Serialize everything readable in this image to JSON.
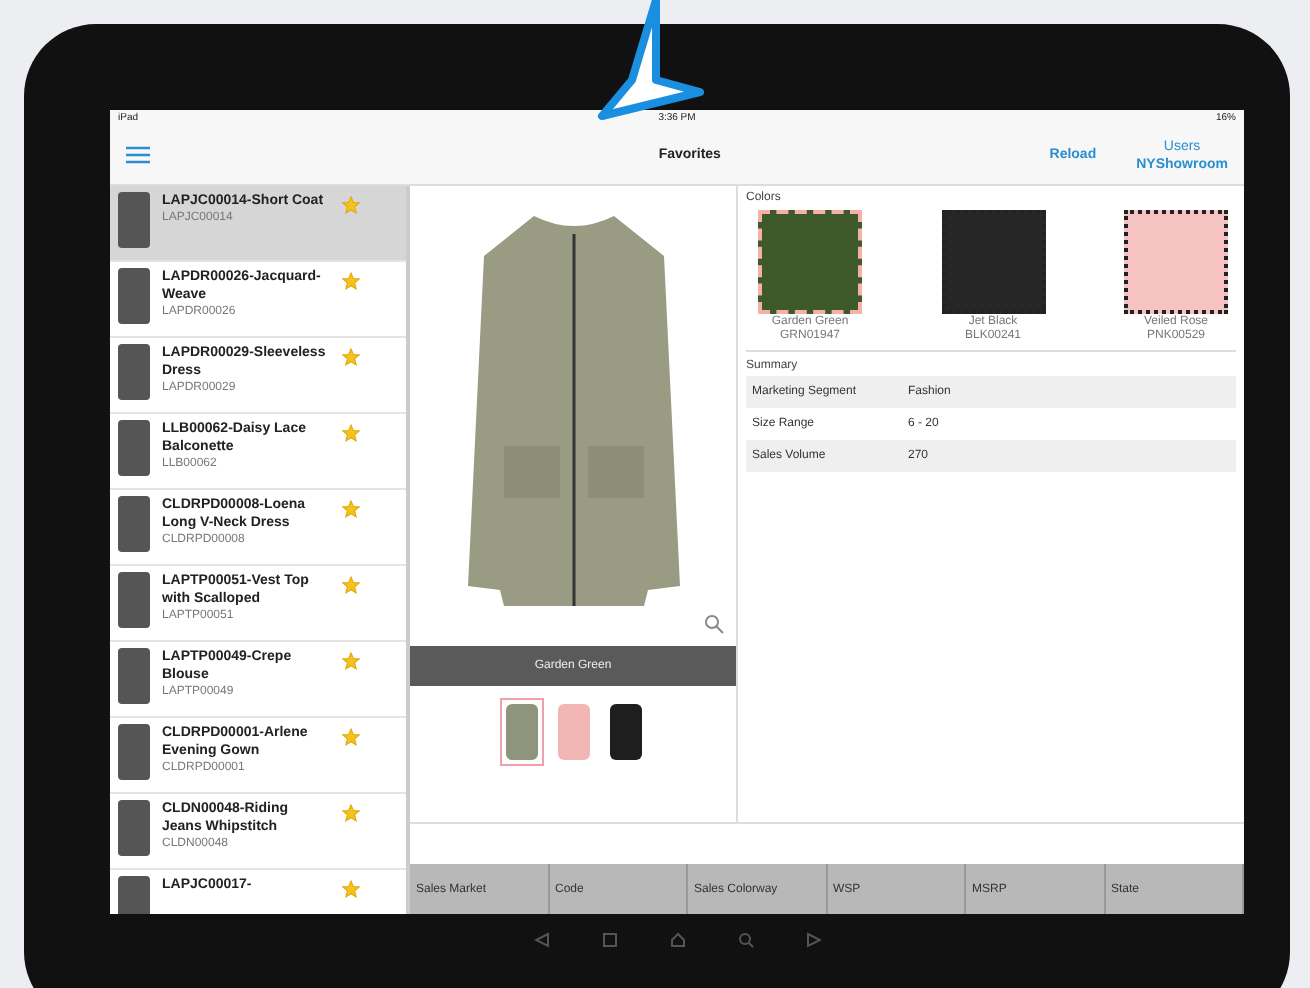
{
  "status_bar": {
    "device": "iPad",
    "time": "3:36 PM",
    "battery": "16%"
  },
  "nav_bar": {
    "title": "Favorites",
    "reload": "Reload",
    "users_label": "Users",
    "users_value": "NYShowroom"
  },
  "items": [
    {
      "title": "LAPJC00014-Short Coat",
      "code": "LAPJC00014",
      "selected": true,
      "favorite": true
    },
    {
      "title": "LAPDR00026-Jacquard-Weave",
      "code": "LAPDR00026",
      "selected": false,
      "favorite": true
    },
    {
      "title": "LAPDR00029-Sleeveless Dress",
      "code": "LAPDR00029",
      "selected": false,
      "favorite": true
    },
    {
      "title": "LLB00062-Daisy Lace Balconette",
      "code": "LLB00062",
      "selected": false,
      "favorite": true
    },
    {
      "title": "CLDRPD00008-Loena Long V-Neck Dress",
      "code": "CLDRPD00008",
      "selected": false,
      "favorite": true
    },
    {
      "title": "LAPTP00051-Vest Top with Scalloped",
      "code": "LAPTP00051",
      "selected": false,
      "favorite": true
    },
    {
      "title": "LAPTP00049-Crepe Blouse",
      "code": "LAPTP00049",
      "selected": false,
      "favorite": true
    },
    {
      "title": "CLDRPD00001-Arlene Evening Gown",
      "code": "CLDRPD00001",
      "selected": false,
      "favorite": true
    },
    {
      "title": "CLDN00048-Riding Jeans Whipstitch",
      "code": "CLDN00048",
      "selected": false,
      "favorite": true
    },
    {
      "title": "LAPJC00017-",
      "selected": false,
      "favorite": true
    }
  ],
  "image_caption": "Garden Green",
  "thumbnails": [
    {
      "color": "#8e957a",
      "selected": true
    },
    {
      "color": "#f2b7b5",
      "selected": false
    },
    {
      "color": "#1e1e1e",
      "selected": false
    }
  ],
  "colors": {
    "label": "Colors",
    "swatches": [
      {
        "name": "Garden Green",
        "code": "GRN01947",
        "color": "#3e5a2b",
        "selected": true
      },
      {
        "name": "Jet Black",
        "code": "BLK00241",
        "color": "#262626",
        "selected": false
      },
      {
        "name": "Veiled Rose",
        "code": "PNK00529",
        "color": "#f5c3c1",
        "selected": false
      }
    ]
  },
  "summary": {
    "label": "Summary",
    "rows": [
      {
        "label": "Marketing Segment",
        "value": "Fashion"
      },
      {
        "label": "Size Range",
        "value": "6 - 20"
      },
      {
        "label": "Sales Volume",
        "value": "270"
      }
    ]
  },
  "table": {
    "columns": [
      "Sales Market",
      "Code",
      "Sales Colorway",
      "WSP",
      "MSRP",
      "State"
    ]
  }
}
